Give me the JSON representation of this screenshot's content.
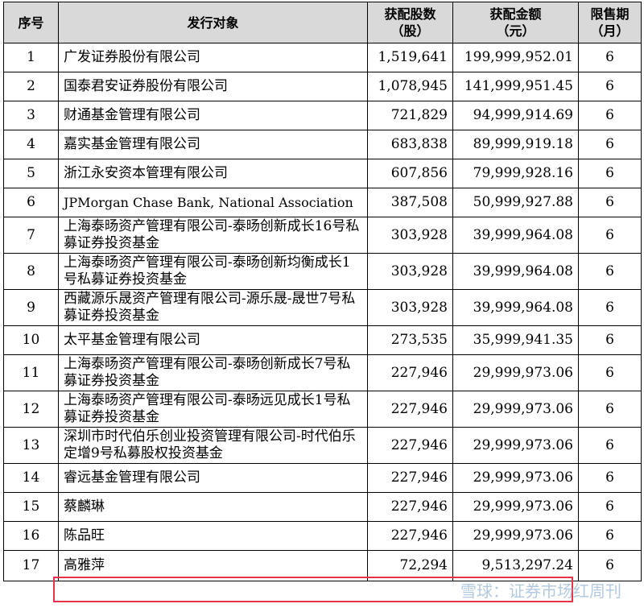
{
  "header": {
    "no": "序号",
    "investor": "发行对象",
    "shares": "获配股数\n（股）",
    "amount": "获配金额\n（元）",
    "lockup": "限售期\n（月）"
  },
  "rows": [
    {
      "no": "1",
      "investor": "广发证券股份有限公司",
      "shares": "1,519,641",
      "amount": "199,999,952.01",
      "lockup": "6"
    },
    {
      "no": "2",
      "investor": "国泰君安证券股份有限公司",
      "shares": "1,078,945",
      "amount": "141,999,951.45",
      "lockup": "6"
    },
    {
      "no": "3",
      "investor": "财通基金管理有限公司",
      "shares": "721,829",
      "amount": "94,999,914.69",
      "lockup": "6"
    },
    {
      "no": "4",
      "investor": "嘉实基金管理有限公司",
      "shares": "683,838",
      "amount": "89,999,919.18",
      "lockup": "6"
    },
    {
      "no": "5",
      "investor": "浙江永安资本管理有限公司",
      "shares": "607,856",
      "amount": "79,999,928.16",
      "lockup": "6"
    },
    {
      "no": "6",
      "investor": "JPMorgan Chase Bank, National Association",
      "shares": "387,508",
      "amount": "50,999,927.88",
      "lockup": "6"
    },
    {
      "no": "7",
      "investor": "上海泰旸资产管理有限公司-泰旸创新成长16号私募证券投资基金",
      "shares": "303,928",
      "amount": "39,999,964.08",
      "lockup": "6"
    },
    {
      "no": "8",
      "investor": "上海泰旸资产管理有限公司-泰旸创新均衡成长1号私募证券投资基金",
      "shares": "303,928",
      "amount": "39,999,964.08",
      "lockup": "6"
    },
    {
      "no": "9",
      "investor": "西藏源乐晟资产管理有限公司-源乐晟-晟世7号私募证券投资基金",
      "shares": "303,928",
      "amount": "39,999,964.08",
      "lockup": "6"
    },
    {
      "no": "10",
      "investor": "太平基金管理有限公司",
      "shares": "273,535",
      "amount": "35,999,941.35",
      "lockup": "6"
    },
    {
      "no": "11",
      "investor": "上海泰旸资产管理有限公司-泰旸创新成长7号私募证券投资基金",
      "shares": "227,946",
      "amount": "29,999,973.06",
      "lockup": "6"
    },
    {
      "no": "12",
      "investor": "上海泰旸资产管理有限公司-泰旸远见成长1号私募证券投资基金",
      "shares": "227,946",
      "amount": "29,999,973.06",
      "lockup": "6"
    },
    {
      "no": "13",
      "investor": "深圳市时代伯乐创业投资管理有限公司-时代伯乐定增9号私募股权投资基金",
      "shares": "227,946",
      "amount": "29,999,973.06",
      "lockup": "6"
    },
    {
      "no": "14",
      "investor": "睿远基金管理有限公司",
      "shares": "227,946",
      "amount": "29,999,973.06",
      "lockup": "6"
    },
    {
      "no": "15",
      "investor": "蔡麟琳",
      "shares": "227,946",
      "amount": "29,999,973.06",
      "lockup": "6"
    },
    {
      "no": "16",
      "investor": "陈品旺",
      "shares": "227,946",
      "amount": "29,999,973.06",
      "lockup": "6"
    },
    {
      "no": "17",
      "investor": "高雅萍",
      "shares": "72,294",
      "amount": "9,513,297.24",
      "lockup": "6"
    }
  ],
  "watermark": "雪球：证券市场红周刊",
  "highlight_color": "#e8334a"
}
